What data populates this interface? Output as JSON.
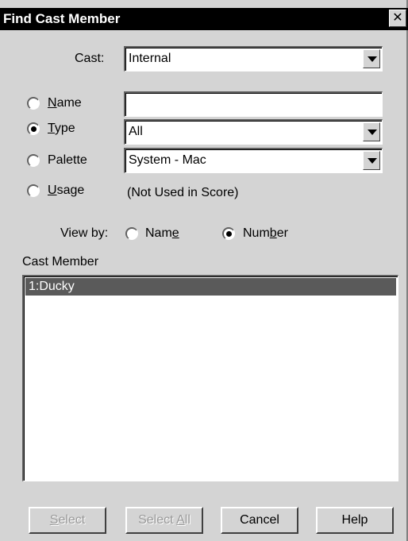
{
  "window": {
    "title": "Find Cast Member",
    "close_glyph": "✕"
  },
  "cast": {
    "label": "Cast:",
    "value": "Internal"
  },
  "search_by": {
    "name": {
      "label_first": "N",
      "label_rest": "ame",
      "value": "",
      "checked": false
    },
    "type": {
      "label_first": "T",
      "label_rest": "ype",
      "value": "All",
      "checked": true
    },
    "palette": {
      "label": "Palette",
      "value": "System - Mac",
      "checked": false
    },
    "usage": {
      "label_first": "U",
      "label_rest": "sage",
      "value": "(Not Used in Score)",
      "checked": false
    }
  },
  "view_by": {
    "label": "View by:",
    "name_pre": "Nam",
    "name_u": "e",
    "name_post": "",
    "number_pre": "Num",
    "number_u": "b",
    "number_post": "er",
    "selected": "Number"
  },
  "cast_member": {
    "label": "Cast Member",
    "items": [
      {
        "text": "1:Ducky",
        "selected": true
      }
    ]
  },
  "buttons": {
    "select_u": "S",
    "select_rest": "elect",
    "select_all_pre": "Select ",
    "select_all_u": "A",
    "select_all_rest": "ll",
    "cancel": "Cancel",
    "help": "Help"
  },
  "icons": {
    "close": "close-icon",
    "dropdown": "chevron-down-icon"
  }
}
